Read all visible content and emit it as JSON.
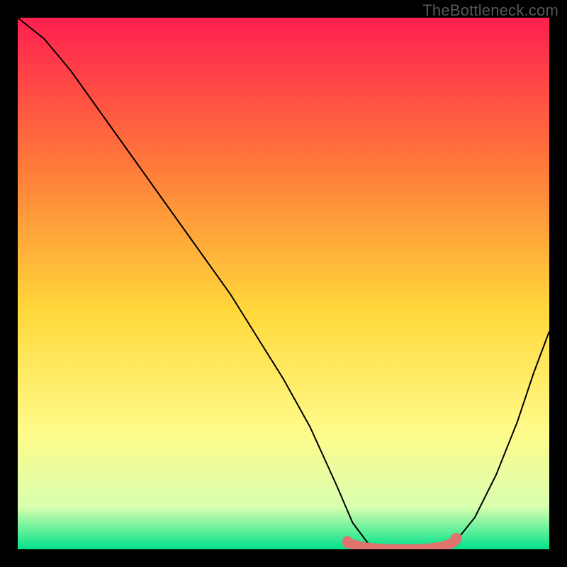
{
  "watermark": "TheBottleneck.com",
  "chart_data": {
    "type": "line",
    "title": "",
    "xlabel": "",
    "ylabel": "",
    "xlim": [
      0,
      100
    ],
    "ylim": [
      0,
      100
    ],
    "gradient_colors": {
      "top": "#ff1f4f",
      "mid_upper": "#ff7a3a",
      "mid": "#ffd83a",
      "mid_lower": "#fffb8a",
      "near_bottom": "#d9ffb0",
      "bottom": "#00e28a"
    },
    "series": [
      {
        "name": "bottleneck-curve",
        "color": "#000000",
        "x": [
          0,
          5,
          10,
          15,
          20,
          25,
          30,
          35,
          40,
          45,
          50,
          55,
          60,
          63,
          66,
          70,
          74,
          78,
          82,
          86,
          90,
          94,
          97,
          100
        ],
        "y": [
          100,
          96,
          90,
          83,
          76,
          69,
          62,
          55,
          48,
          40,
          32,
          23,
          12,
          5,
          1,
          0,
          0,
          0,
          1,
          6,
          14,
          24,
          33,
          41
        ]
      },
      {
        "name": "optimal-range-marker",
        "color": "#e0736d",
        "x": [
          62,
          65,
          68,
          71,
          74,
          77,
          80,
          82
        ],
        "y": [
          1.2,
          0.4,
          0.1,
          0.0,
          0.0,
          0.1,
          0.5,
          1.3
        ]
      }
    ],
    "markers": [
      {
        "name": "start-dot",
        "x": 62,
        "y": 1.6,
        "r": 1.0,
        "color": "#e0736d"
      },
      {
        "name": "end-dot",
        "x": 82.5,
        "y": 2.0,
        "r": 1.2,
        "color": "#e0736d"
      }
    ]
  }
}
